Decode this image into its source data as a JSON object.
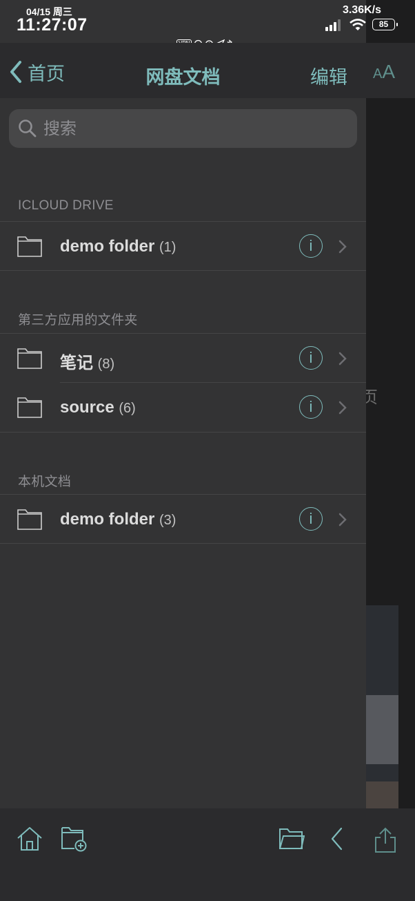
{
  "status": {
    "date": "04/15 周三",
    "time": "11:27:07",
    "speed": "3.36K/s",
    "vpn": "VPN",
    "battery": "85"
  },
  "nav": {
    "back_label": "首页",
    "title": "网盘文档",
    "edit_label": "编辑"
  },
  "search": {
    "placeholder": "搜索"
  },
  "background": {
    "aa_small": "A",
    "aa_large": "A",
    "partial_char": "页"
  },
  "sections": [
    {
      "header": "ICLOUD DRIVE",
      "items": [
        {
          "name": "demo folder",
          "count": "(1)"
        }
      ]
    },
    {
      "header": "第三方应用的文件夹",
      "items": [
        {
          "name": "笔记",
          "count": "(8)"
        },
        {
          "name": "source",
          "count": "(6)"
        }
      ]
    },
    {
      "header": "本机文档",
      "items": [
        {
          "name": "demo folder",
          "count": "(3)"
        }
      ]
    }
  ],
  "info_glyph": "i",
  "icons": {
    "back": "chevron-left-icon",
    "search": "search-icon",
    "folder": "folder-icon",
    "info": "info-icon",
    "disclosure": "chevron-right-icon",
    "home": "home-icon",
    "new_folder": "new-folder-icon",
    "open_folder": "open-folder-icon",
    "prev": "chevron-left-icon",
    "share": "share-icon"
  },
  "colors": {
    "accent": "#7fbcbc",
    "panel": "#333334",
    "bar": "#2b2b2d"
  }
}
